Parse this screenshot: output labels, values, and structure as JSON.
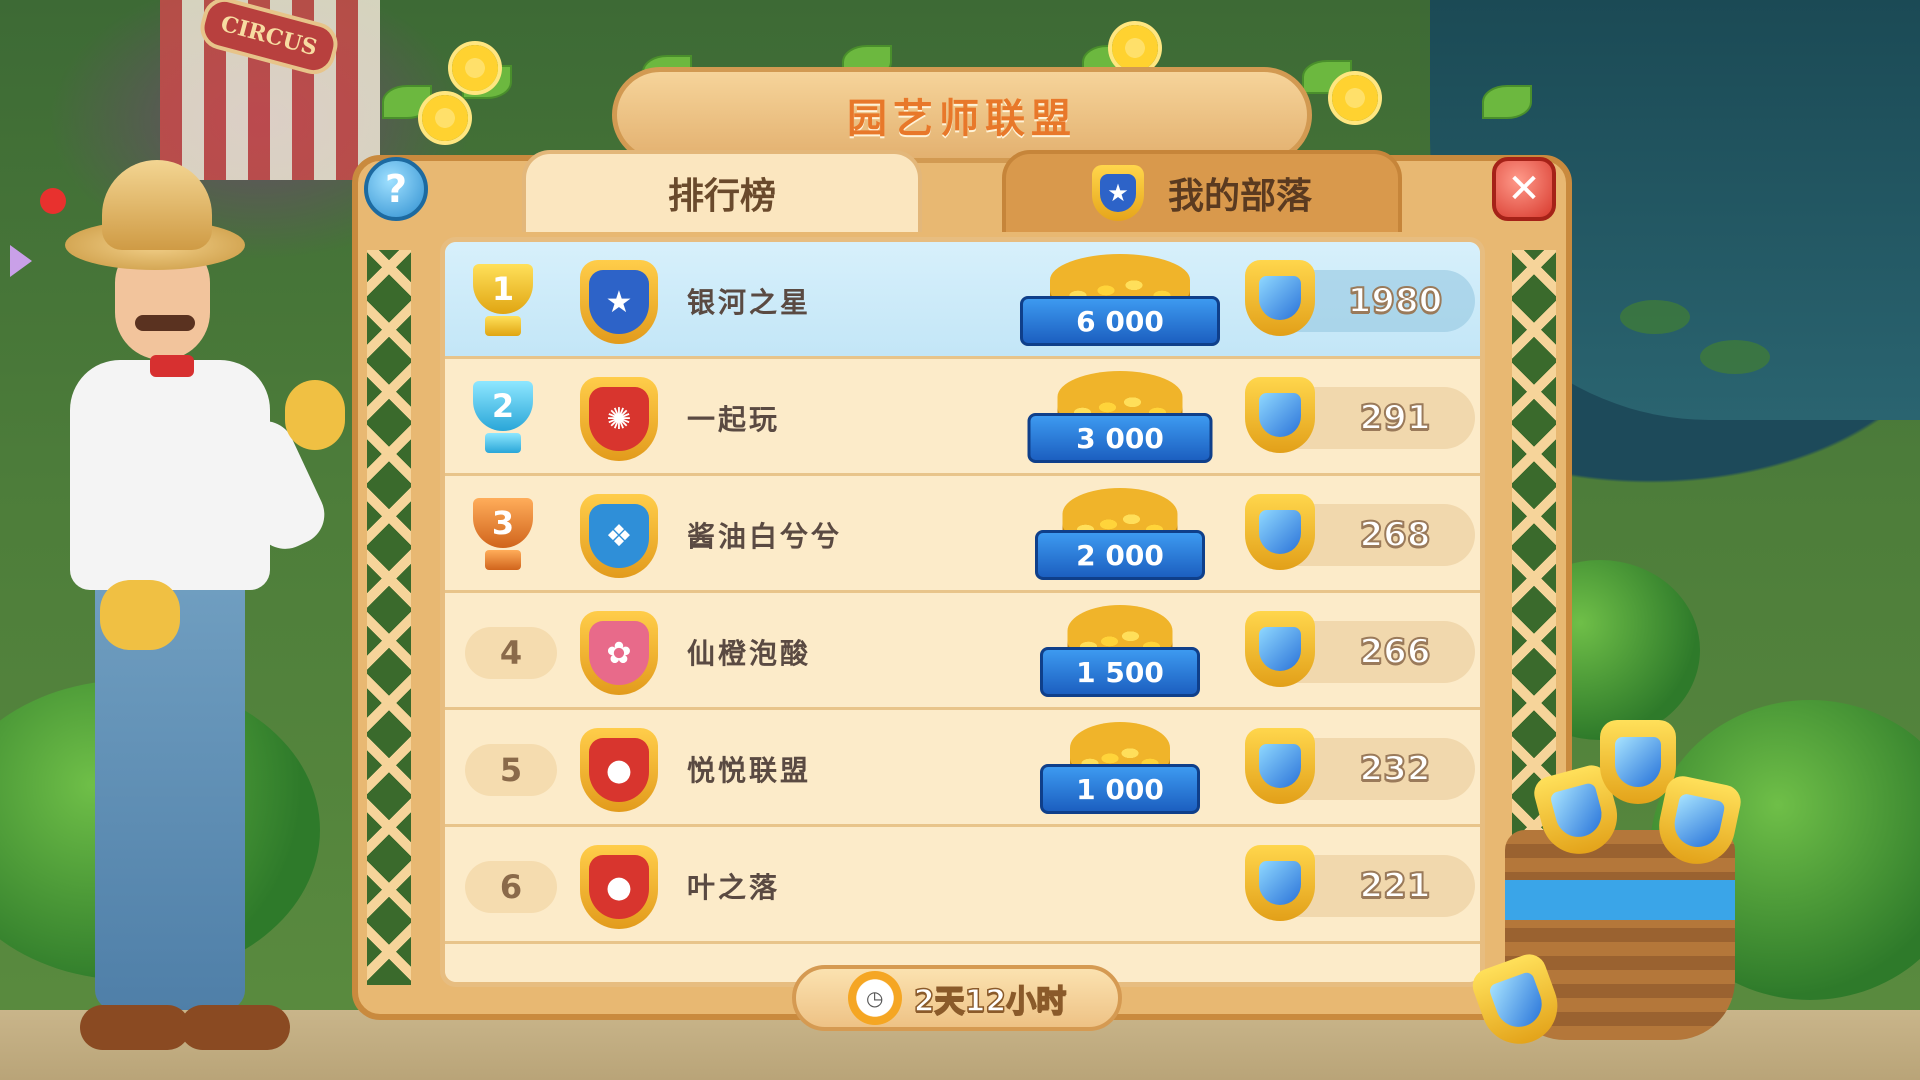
{
  "header": {
    "title": "园艺师联盟",
    "sign": "CIRCUS"
  },
  "tabs": [
    {
      "label": "排行榜",
      "active": true
    },
    {
      "label": "我的部落",
      "active": false
    }
  ],
  "buttons": {
    "help": "?",
    "close": "✕"
  },
  "leaderboard": [
    {
      "rank": "1",
      "name": "银河之星",
      "reward": "6 000",
      "score": "1980",
      "badge_color": "#2d63c8",
      "badge_icon": "star-icon",
      "badge_glyph": "★"
    },
    {
      "rank": "2",
      "name": "一起玩",
      "reward": "3 000",
      "score": "291",
      "badge_color": "#d8352e",
      "badge_icon": "sun-icon",
      "badge_glyph": "✺"
    },
    {
      "rank": "3",
      "name": "酱油白兮兮",
      "reward": "2 000",
      "score": "268",
      "badge_color": "#2f8fd8",
      "badge_icon": "paw-icon",
      "badge_glyph": "❖"
    },
    {
      "rank": "4",
      "name": "仙橙泡酸",
      "reward": "1 500",
      "score": "266",
      "badge_color": "#e86a8a",
      "badge_icon": "flower-icon",
      "badge_glyph": "✿"
    },
    {
      "rank": "5",
      "name": "悦悦联盟",
      "reward": "1 000",
      "score": "232",
      "badge_color": "#d8352e",
      "badge_icon": "acorn-icon",
      "badge_glyph": "●"
    },
    {
      "rank": "6",
      "name": "叶之落",
      "reward": "",
      "score": "221",
      "badge_color": "#d8352e",
      "badge_icon": "apple-icon",
      "badge_glyph": "●"
    }
  ],
  "timer": {
    "text": "2天12小时"
  },
  "colors": {
    "accent": "#e8782a",
    "gold": "#ffd64c",
    "ribbon": "#1c5fc0",
    "highlight_row": "#c3e6f7"
  }
}
